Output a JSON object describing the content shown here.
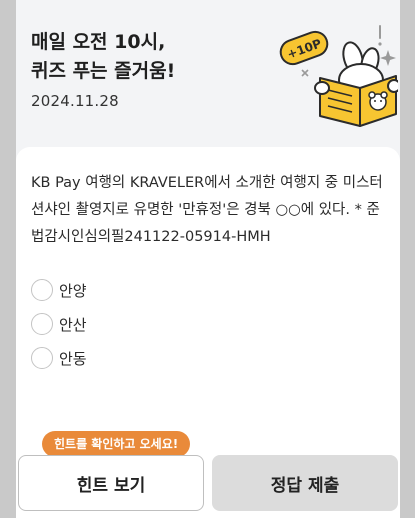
{
  "header": {
    "title": "매일 오전 10시,\n퀴즈 푸는 즐거움!",
    "date": "2024.11.28",
    "badge": "+10P"
  },
  "question": {
    "text": "KB Pay 여행의 KRAVELER에서 소개한 여행지 중 미스터 션샤인 촬영지로 유명한 '만휴정'은 경북 ○○에 있다. * 준법감시인심의필241122-05914-HMH"
  },
  "options": [
    "안양",
    "안산",
    "안동"
  ],
  "hint_tooltip": "힌트를 확인하고 오세요!",
  "buttons": {
    "hint": "힌트 보기",
    "submit": "정답 제출"
  },
  "colors": {
    "accent": "#e98a3a",
    "illustration_yellow": "#f7c531",
    "header_bg": "#f3f4f6"
  },
  "icons": [
    "point-badge-icon",
    "reading-mascot-icon",
    "sparkle-icon"
  ]
}
